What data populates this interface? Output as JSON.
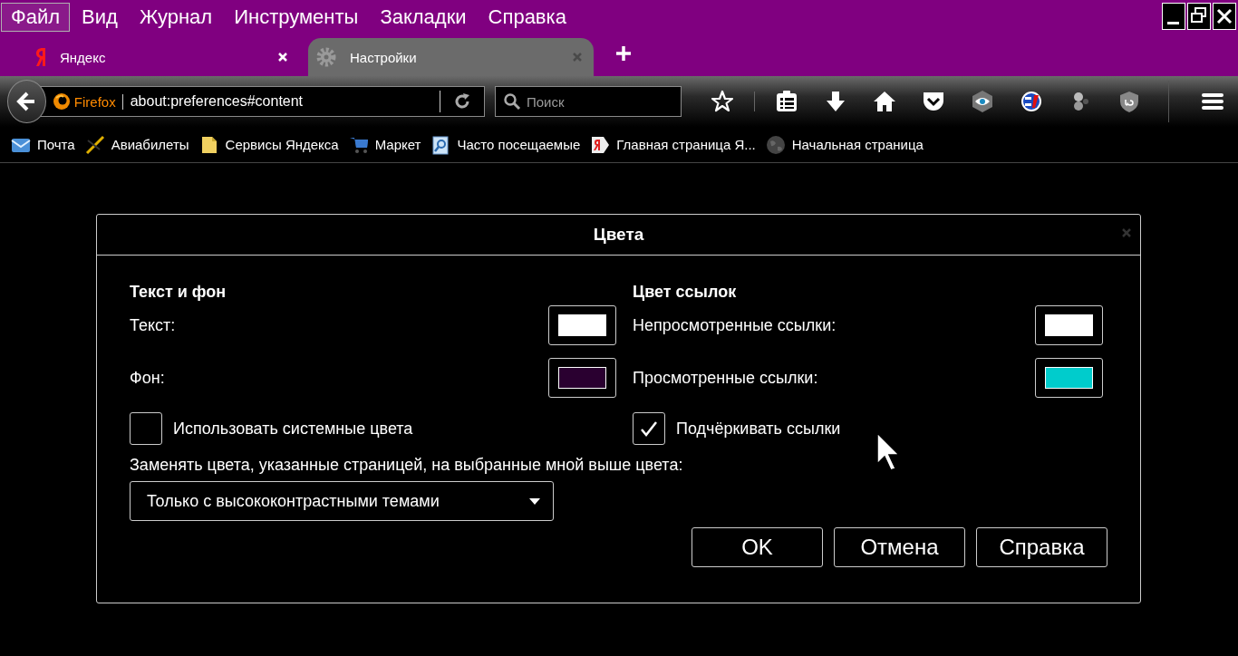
{
  "menu": [
    {
      "label": "Файл",
      "selected": true
    },
    {
      "label": "Вид",
      "selected": false
    },
    {
      "label": "Журнал",
      "selected": false
    },
    {
      "label": "Инструменты",
      "selected": false
    },
    {
      "label": "Закладки",
      "selected": false
    },
    {
      "label": "Справка",
      "selected": false
    }
  ],
  "tabs": [
    {
      "label": "Яндекс",
      "selected": false
    },
    {
      "label": "Настройки",
      "selected": true
    }
  ],
  "navbar": {
    "identity": "Firefox",
    "url": "about:preferences#content",
    "search": {
      "placeholder": "Поиск"
    }
  },
  "bookmarks": [
    {
      "label": "Почта"
    },
    {
      "label": "Авиабилеты"
    },
    {
      "label": "Сервисы Яндекса"
    },
    {
      "label": "Маркет"
    },
    {
      "label": "Часто посещаемые"
    },
    {
      "label": "Главная страница Я..."
    },
    {
      "label": "Начальная страница"
    }
  ],
  "dialog": {
    "title": "Цвета",
    "sections": [
      {
        "heading": "Текст и фон",
        "rows": [
          {
            "label": "Текст:",
            "color": "#ffffff"
          },
          {
            "label": "Фон:",
            "color": "#2a0030"
          }
        ]
      },
      {
        "heading": "Цвет ссылок",
        "rows": [
          {
            "label": "Непросмотренные ссылки:",
            "color": "#ffffff"
          },
          {
            "label": "Просмотренные ссылки:",
            "color": "#00cccc"
          }
        ]
      }
    ],
    "checkboxes": [
      {
        "label": "Использовать системные цвета",
        "checked": false
      },
      {
        "label": "Подчёркивать ссылки",
        "checked": true
      }
    ],
    "override": {
      "label": "Заменять цвета, указанные страницей, на выбранные мной выше цвета:"
    },
    "select": {
      "value": "Только с высококонтрастными темами"
    },
    "buttons": [
      {
        "label": "OK"
      },
      {
        "label": "Отмена"
      },
      {
        "label": "Справка"
      }
    ]
  }
}
